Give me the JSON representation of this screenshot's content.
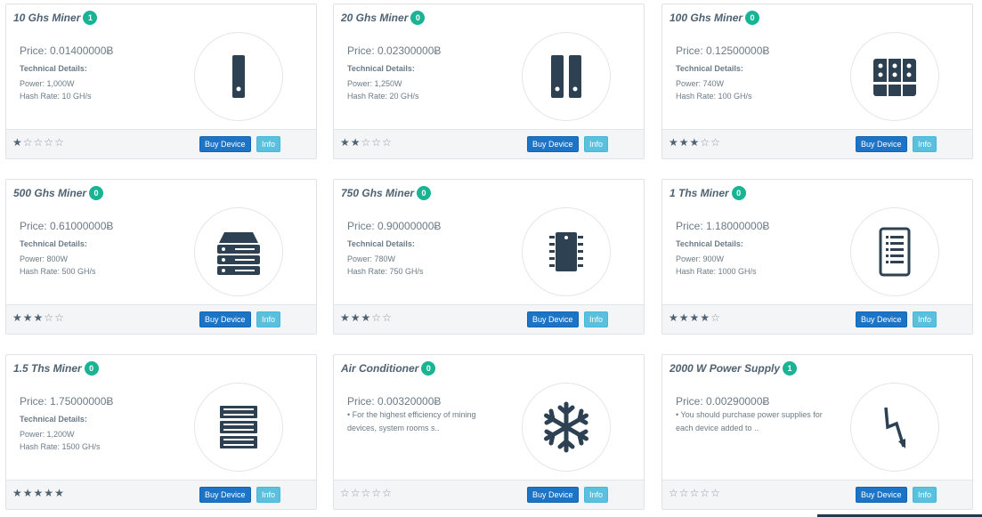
{
  "ui": {
    "buy_label": "Buy Device",
    "info_label": "Info",
    "tech_label": "Technical Details:"
  },
  "colors": {
    "badge": "#1ab394",
    "buy_button": "#1c74c6",
    "info_button": "#5bc0de",
    "icon": "#2d4153"
  },
  "cards": [
    {
      "title": "10 Ghs Miner",
      "count": "1",
      "price": "Price: 0.01400000Ƀ",
      "power": "Power: 1,000W",
      "hash": "Hash Rate: 10 GH/s",
      "rating": 1,
      "icon": "single-rack-icon"
    },
    {
      "title": "20 Ghs Miner",
      "count": "0",
      "price": "Price: 0.02300000Ƀ",
      "power": "Power: 1,250W",
      "hash": "Hash Rate: 20 GH/s",
      "rating": 2,
      "icon": "double-rack-icon"
    },
    {
      "title": "100 Ghs Miner",
      "count": "0",
      "price": "Price: 0.12500000Ƀ",
      "power": "Power: 740W",
      "hash": "Hash Rate: 100 GH/s",
      "rating": 3,
      "icon": "triple-rack-icon"
    },
    {
      "title": "500 Ghs Miner",
      "count": "0",
      "price": "Price: 0.61000000Ƀ",
      "power": "Power: 800W",
      "hash": "Hash Rate: 500 GH/s",
      "rating": 3,
      "icon": "server-stack-icon"
    },
    {
      "title": "750 Ghs Miner",
      "count": "0",
      "price": "Price: 0.90000000Ƀ",
      "power": "Power: 780W",
      "hash": "Hash Rate: 750 GH/s",
      "rating": 3,
      "icon": "chip-icon"
    },
    {
      "title": "1 Ths Miner",
      "count": "0",
      "price": "Price: 1.18000000Ƀ",
      "power": "Power: 900W",
      "hash": "Hash Rate: 1000 GH/s",
      "rating": 4,
      "icon": "server-panel-icon"
    },
    {
      "title": "1.5 Ths Miner",
      "count": "0",
      "price": "Price: 1.75000000Ƀ",
      "power": "Power: 1,200W",
      "hash": "Hash Rate: 1500 GH/s",
      "rating": 5,
      "icon": "rack-server-icon"
    },
    {
      "title": "Air Conditioner",
      "count": "0",
      "price": "Price: 0.00320000Ƀ",
      "description": "•  For the highest efficiency of mining devices, system rooms s..",
      "rating": 0,
      "icon": "snowflake-icon"
    },
    {
      "title": "2000 W Power Supply",
      "count": "1",
      "price": "Price: 0.00290000Ƀ",
      "description": "•  You should purchase power supplies for each device added to ..",
      "rating": 0,
      "icon": "lightning-icon"
    }
  ]
}
